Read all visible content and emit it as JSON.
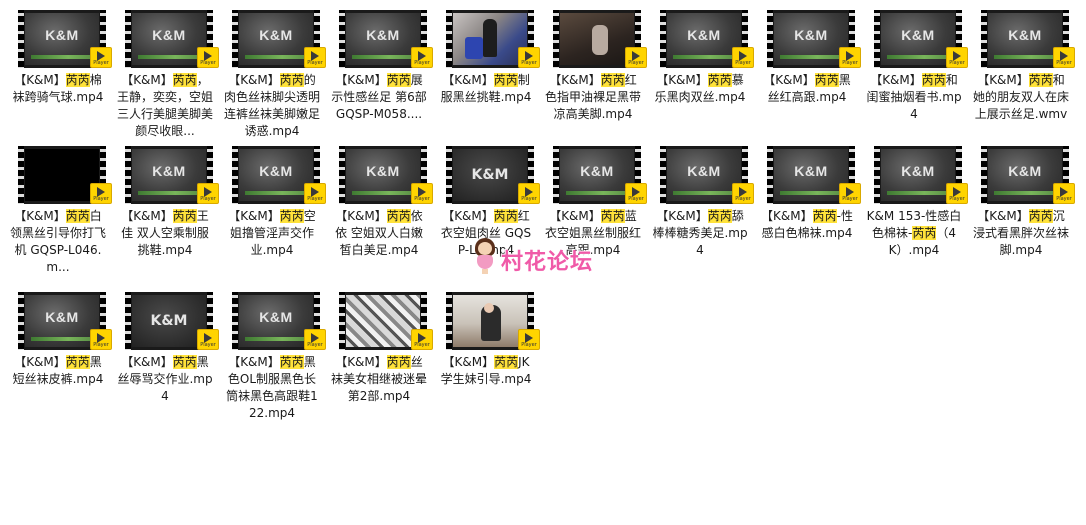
{
  "badge_label": "Player",
  "highlight_color": "#ffe23a",
  "watermark_text": "村花论坛",
  "files": [
    {
      "pre": "【K&M】",
      "hl": "芮芮",
      "post": "棉袜跨骑气球.mp4",
      "thumb": "km"
    },
    {
      "pre": "【K&M】",
      "hl": "芮芮",
      "post": "，王静，奕奕，空姐三人行美腿美脚美颜尽收眼...",
      "thumb": "km"
    },
    {
      "pre": "【K&M】",
      "hl": "芮芮",
      "post": "的肉色丝袜脚尖透明连裤丝袜美脚嫩足诱惑.mp4",
      "thumb": "km"
    },
    {
      "pre": "【K&M】",
      "hl": "芮芮",
      "post": "展示性感丝足 第6部 GQSP-M058....",
      "thumb": "km"
    },
    {
      "pre": "【K&M】",
      "hl": "芮芮",
      "post": "制服黑丝挑鞋.mp4",
      "thumb": "photo1"
    },
    {
      "pre": "【K&M】",
      "hl": "芮芮",
      "post": "红色指甲油裸足黑带凉高美脚.mp4",
      "thumb": "photo2"
    },
    {
      "pre": "【K&M】",
      "hl": "芮芮",
      "post": "慕乐黑肉双丝.mp4",
      "thumb": "km"
    },
    {
      "pre": "【K&M】",
      "hl": "芮芮",
      "post": "黑丝红高跟.mp4",
      "thumb": "km"
    },
    {
      "pre": "【K&M】",
      "hl": "芮芮",
      "post": "和闺蜜抽烟看书.mp4",
      "thumb": "km"
    },
    {
      "pre": "【K&M】",
      "hl": "芮芮",
      "post": "和她的朋友双人在床上展示丝足.wmv",
      "thumb": "km"
    },
    {
      "pre": "【K&M】",
      "hl": "芮芮",
      "post": "白领黑丝引导你打飞机 GQSP-L046.m...",
      "thumb": "black"
    },
    {
      "pre": "【K&M】",
      "hl": "芮芮",
      "post": "王佳 双人空乘制服挑鞋.mp4",
      "thumb": "km"
    },
    {
      "pre": "【K&M】",
      "hl": "芮芮",
      "post": "空姐撸管淫声交作业.mp4",
      "thumb": "km"
    },
    {
      "pre": "【K&M】",
      "hl": "芮芮",
      "post": "依依 空姐双人白嫩皙白美足.mp4",
      "thumb": "km"
    },
    {
      "pre": "【K&M】",
      "hl": "芮芮",
      "post": "红衣空姐肉丝 GQSP-L...mp4",
      "thumb": "dark"
    },
    {
      "pre": "【K&M】",
      "hl": "芮芮",
      "post": "蓝衣空姐黑丝制服红高跟.mp4",
      "thumb": "km"
    },
    {
      "pre": "【K&M】",
      "hl": "芮芮",
      "post": "舔棒棒糖秀美足.mp4",
      "thumb": "km"
    },
    {
      "pre": "【K&M】",
      "hl": "芮芮",
      "post": "-性感白色棉袜.mp4",
      "thumb": "km"
    },
    {
      "pre": "K&M 153-性感白色棉袜-",
      "hl": "芮芮",
      "post": "（4K）.mp4",
      "thumb": "km"
    },
    {
      "pre": "【K&M】",
      "hl": "芮芮",
      "post": "沉浸式看黑胖次丝袜脚.mp4",
      "thumb": "km"
    },
    {
      "pre": "【K&M】",
      "hl": "芮芮",
      "post": "黑短丝袜皮裤.mp4",
      "thumb": "km"
    },
    {
      "pre": "【K&M】",
      "hl": "芮芮",
      "post": "黑丝辱骂交作业.mp4",
      "thumb": "dark"
    },
    {
      "pre": "【K&M】",
      "hl": "芮芮",
      "post": "黑色OL制服黑色长筒袜黑色高跟鞋122.mp4",
      "thumb": "km"
    },
    {
      "pre": "【K&M】",
      "hl": "芮芮",
      "post": "丝袜美女相继被迷晕 第2部.mp4",
      "thumb": "glitch"
    },
    {
      "pre": "【K&M】",
      "hl": "芮芮",
      "post": "JK学生妹引导.mp4",
      "thumb": "photo3"
    }
  ]
}
